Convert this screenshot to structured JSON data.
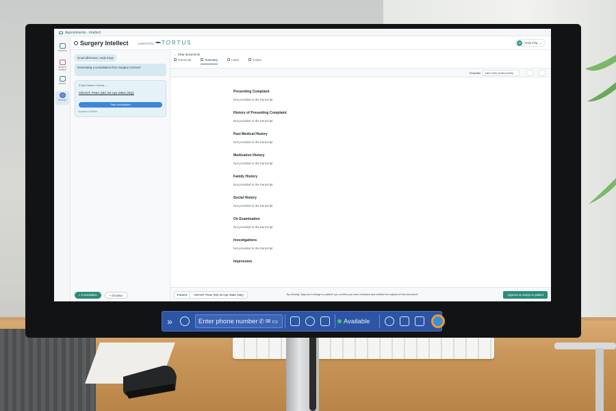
{
  "app": {
    "breadcrumb": "Appointments - Intellect",
    "title": "Surgery Intellect",
    "powered_by": "powered by",
    "brand": "TORTUS",
    "user_initials": "AK",
    "user_name": "Andy King"
  },
  "rail": {
    "items": [
      {
        "label": "Sessions"
      },
      {
        "label": "Surgery Intellect"
      },
      {
        "label": "Archive"
      },
      {
        "label": "Modules"
      }
    ]
  },
  "chat": {
    "greeting": "Good afternoon, Andy King!",
    "generating": "Generating a consultation from Surgery Connect",
    "add_context": "Add Patient Context",
    "patient": "GRANT, Peter (Mr) 20-Apr-2964 (40y)",
    "start_button": "Start consultation",
    "expires": "Expires in 309.8m",
    "mode_consultation": "Consultation",
    "mode_dictation": "Dictation"
  },
  "main": {
    "clear_docs": "Clear documents",
    "tabs": [
      "Transcript",
      "Summary",
      "Letter",
      "Codes"
    ],
    "active_tab": "Summary",
    "template_label": "Template:",
    "template_value": "Clinic Note (bullet points)",
    "sections": [
      {
        "title": "Presenting Complaint",
        "body": "Not provided in the transcript"
      },
      {
        "title": "History of Presenting Complaint",
        "body": "Not provided in the transcript"
      },
      {
        "title": "Past Medical History",
        "body": "Not provided in the transcript"
      },
      {
        "title": "Medication History",
        "body": "Not provided in the transcript"
      },
      {
        "title": "Family History",
        "body": "Not provided in the transcript"
      },
      {
        "title": "Social History",
        "body": "Not provided in the transcript"
      },
      {
        "title": "On Examination",
        "body": "Not provided in the transcript"
      },
      {
        "title": "Investigations",
        "body": "Not provided in the transcript"
      },
      {
        "title": "Impression",
        "body": ""
      }
    ]
  },
  "footer": {
    "patient_tag": "Patient",
    "patient_name": "GRANT, Peter (Mr) 20-Apr-2964 (40y)",
    "disclaimer": "By clicking \"Approve & Assign to patient\" you confirm you have reviewed and verified the outputs of this document.",
    "approve_button": "Approve & Assign to patient"
  },
  "phonebar": {
    "expand": "»",
    "phone_placeholder": "Enter phone number",
    "status": "Available"
  },
  "colors": {
    "accent": "#2a8b78",
    "brand": "#2a8e9c",
    "phonebar": "#2d55a5"
  }
}
